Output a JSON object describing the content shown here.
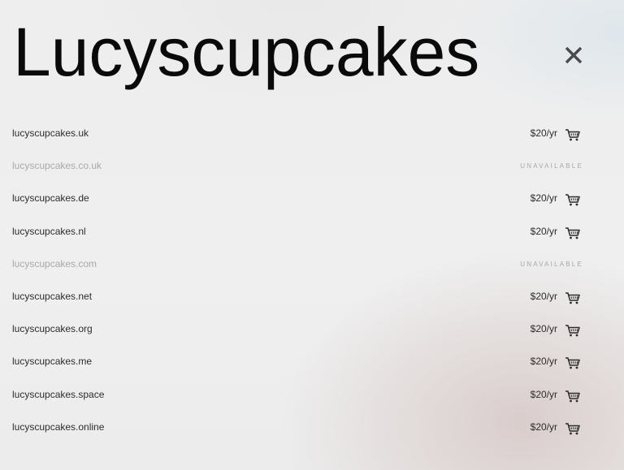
{
  "header": {
    "title": "Lucyscupcakes",
    "close_icon": "close-icon"
  },
  "results": [
    {
      "domain": "lucyscupcakes.uk",
      "available": true,
      "price": "$20/yr",
      "icon": "cart-icon"
    },
    {
      "domain": "lucyscupcakes.co.uk",
      "available": false,
      "status": "UNAVAILABLE"
    },
    {
      "domain": "lucyscupcakes.de",
      "available": true,
      "price": "$20/yr",
      "icon": "cart-icon"
    },
    {
      "domain": "lucyscupcakes.nl",
      "available": true,
      "price": "$20/yr",
      "icon": "cart-icon"
    },
    {
      "domain": "lucyscupcakes.com",
      "available": false,
      "status": "UNAVAILABLE"
    },
    {
      "domain": "lucyscupcakes.net",
      "available": true,
      "price": "$20/yr",
      "icon": "cart-icon"
    },
    {
      "domain": "lucyscupcakes.org",
      "available": true,
      "price": "$20/yr",
      "icon": "cart-icon"
    },
    {
      "domain": "lucyscupcakes.me",
      "available": true,
      "price": "$20/yr",
      "icon": "cart-icon"
    },
    {
      "domain": "lucyscupcakes.space",
      "available": true,
      "price": "$20/yr",
      "icon": "cart-icon"
    },
    {
      "domain": "lucyscupcakes.online",
      "available": true,
      "price": "$20/yr",
      "icon": "cart-icon"
    }
  ],
  "colors": {
    "title": "#0a0a0a",
    "text": "#2c2c2c",
    "muted": "#a8a8a8",
    "close": "#4a4a4a"
  }
}
